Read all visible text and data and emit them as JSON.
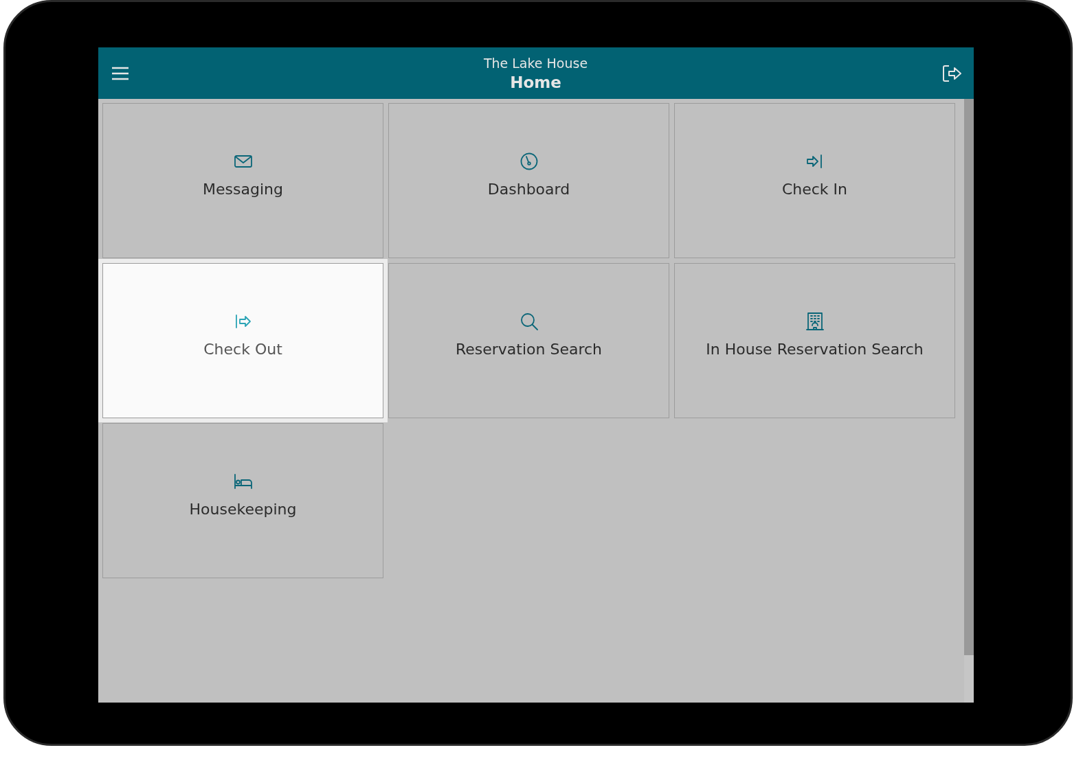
{
  "header": {
    "subtitle": "The Lake House",
    "title": "Home"
  },
  "tiles": [
    {
      "kind": "messaging",
      "label": "Messaging",
      "selected": false
    },
    {
      "kind": "dashboard",
      "label": "Dashboard",
      "selected": false
    },
    {
      "kind": "check-in",
      "label": "Check In",
      "selected": false
    },
    {
      "kind": "check-out",
      "label": "Check Out",
      "selected": true
    },
    {
      "kind": "search",
      "label": "Reservation Search",
      "selected": false
    },
    {
      "kind": "in-house",
      "label": "In House Reservation Search",
      "selected": false
    },
    {
      "kind": "housekeeping",
      "label": "Housekeeping",
      "selected": false
    }
  ]
}
